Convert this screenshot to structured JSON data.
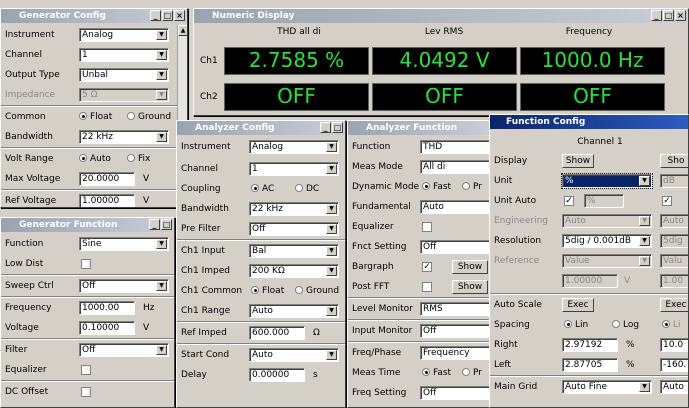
{
  "gen": {
    "title": "Generator Config",
    "rows": [
      {
        "label": "Instrument",
        "value": "Analog"
      },
      {
        "label": "Channel",
        "value": "1"
      },
      {
        "label": "Output Type",
        "value": "Unbal"
      },
      {
        "label": "Impedance",
        "value": "5 Ω"
      },
      {
        "label": "Common",
        "opt1": "Float",
        "opt2": "Ground"
      },
      {
        "label": "Bandwidth",
        "value": "22 kHz"
      },
      {
        "label": "Volt Range",
        "opt1": "Auto",
        "opt2": "Fix"
      },
      {
        "label": "Max Voltage",
        "value": "20.0000",
        "unit": "V"
      },
      {
        "label": "Ref Voltage",
        "value": "1.00000",
        "unit": "V"
      }
    ]
  },
  "genf": {
    "title": "Generator Function",
    "rows": [
      {
        "label": "Function",
        "value": "Sine"
      },
      {
        "label": "Low Dist"
      },
      {
        "label": "Sweep Ctrl",
        "value": "Off"
      },
      {
        "label": "Frequency",
        "value": "1000.00",
        "unit": "Hz"
      },
      {
        "label": "Voltage",
        "value": "0.10000",
        "unit": "V"
      },
      {
        "label": "Filter",
        "value": "Off"
      },
      {
        "label": "Equalizer"
      },
      {
        "label": "DC Offset"
      }
    ]
  },
  "num": {
    "title": "Numeric Display",
    "cols": [
      "THD all di",
      "Lev RMS",
      "Frequency"
    ],
    "ch1": {
      "label": "Ch1",
      "vals": [
        "2.7585 %",
        "4.0492 V",
        "1000.0 Hz"
      ]
    },
    "ch2": {
      "label": "Ch2",
      "vals": [
        "OFF",
        "OFF",
        "OFF"
      ]
    }
  },
  "ana": {
    "title": "Analyzer Config",
    "rows": [
      {
        "label": "Instrument",
        "value": "Analog"
      },
      {
        "label": "Channel",
        "value": "1"
      },
      {
        "label": "Coupling",
        "opt1": "AC",
        "opt2": "DC"
      },
      {
        "label": "Bandwidth",
        "value": "22 kHz"
      },
      {
        "label": "Pre Filter",
        "value": "Off"
      },
      {
        "label": "Ch1 Input",
        "value": "Bal"
      },
      {
        "label": "Ch1 Imped",
        "value": "200 KΩ"
      },
      {
        "label": "Ch1 Common",
        "opt1": "Float",
        "opt2": "Ground"
      },
      {
        "label": "Ch1 Range",
        "value": "Auto"
      },
      {
        "label": "Ref Imped",
        "value": "600.000",
        "unit": "Ω"
      },
      {
        "label": "Start Cond",
        "value": "Auto"
      },
      {
        "label": "Delay",
        "value": "0.00000",
        "unit": "s"
      }
    ]
  },
  "anf": {
    "title": "Analyzer Function",
    "rows": [
      {
        "label": "Function",
        "value": "THD"
      },
      {
        "label": "Meas Mode",
        "value": "All di"
      },
      {
        "label": "Dynamic Mode",
        "opt1": "Fast",
        "opt2": "Pr"
      },
      {
        "label": "Fundamental",
        "value": "Auto"
      },
      {
        "label": "Equalizer"
      },
      {
        "label": "Fnct Setting",
        "value": "Off"
      },
      {
        "label": "Bargraph",
        "btn": "Show"
      },
      {
        "label": "Post FFT",
        "btn": "Show"
      },
      {
        "label": "Level Monitor",
        "value": "RMS"
      },
      {
        "label": "Input Monitor",
        "value": "Off"
      },
      {
        "label": "Freq/Phase",
        "value": "Frequency"
      },
      {
        "label": "Meas Time",
        "opt1": "Fast",
        "opt2": "Pr"
      },
      {
        "label": "Freq Setting",
        "value": "Off"
      }
    ]
  },
  "fc": {
    "title": "Function Config",
    "channel": "Channel 1",
    "display": {
      "label": "Display",
      "btn": "Show",
      "btn2": "Sho"
    },
    "unit": {
      "label": "Unit",
      "value": "%",
      "v2": "dB"
    },
    "unitauto": {
      "label": "Unit Auto",
      "value": "%"
    },
    "eng": {
      "label": "Engineering",
      "value": "Auto",
      "v2": "Auto"
    },
    "res": {
      "label": "Resolution",
      "value": "5dig / 0.001dB",
      "v2": "5dig"
    },
    "ref": {
      "label": "Reference",
      "value": "Value",
      "v2": "Valu",
      "num": "1.00000",
      "unit": "V",
      "num2": "1.00"
    },
    "autoscale": {
      "label": "Auto Scale",
      "btn": "Exec",
      "btn2": "Exec"
    },
    "spacing": {
      "label": "Spacing",
      "opt1": "Lin",
      "opt2": "Log",
      "opt3": "Li"
    },
    "right": {
      "label": "Right",
      "value": "2.97192",
      "unit": "%",
      "v2": "10.0"
    },
    "left": {
      "label": "Left",
      "value": "2.87705",
      "unit": "%",
      "v2": "-160."
    },
    "grid": {
      "label": "Main Grid",
      "value": "Auto Fine",
      "v2": "Auto"
    }
  }
}
